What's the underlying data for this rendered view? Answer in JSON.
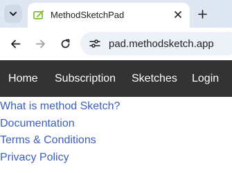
{
  "browser": {
    "tab_title": "MethodSketchPad",
    "url": "pad.methodsketch.app",
    "icons": {
      "tab_search": "chevron-down-icon",
      "favicon": "sketchpad-favicon-icon",
      "tab_close": "close-icon",
      "new_tab": "plus-icon",
      "back": "arrow-left-icon",
      "forward": "arrow-right-icon",
      "reload": "reload-icon",
      "site_info": "tune-icon"
    },
    "colors": {
      "tabstrip_bg": "#dfe7f3",
      "omnibox_bg": "#edf1f8",
      "favicon": "#8bc34a"
    }
  },
  "site_nav": {
    "items": [
      {
        "label": "Home"
      },
      {
        "label": "Subscription"
      },
      {
        "label": "Sketches"
      },
      {
        "label": "Login"
      }
    ],
    "colors": {
      "bg": "#333333",
      "text": "#ffffff"
    }
  },
  "links": {
    "items": [
      {
        "label": "What is method Sketch?"
      },
      {
        "label": "Documentation"
      },
      {
        "label": "Terms & Conditions"
      },
      {
        "label": "Privacy Policy"
      }
    ],
    "color": "#3b5fc0"
  }
}
